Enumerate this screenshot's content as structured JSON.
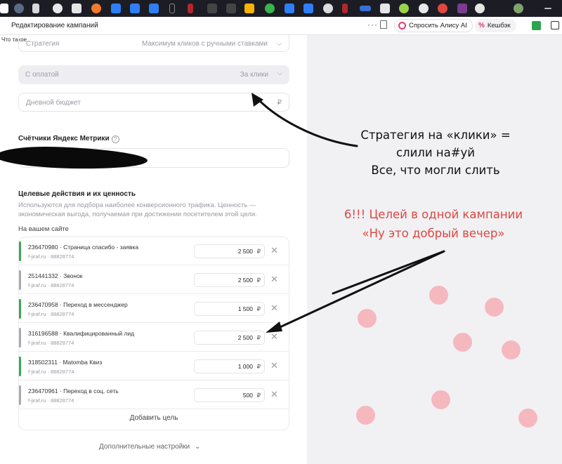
{
  "browser": {
    "page_title": "Редактирование кампаний",
    "more_label": "···",
    "alice_button": "Спросить Алису AI",
    "cashback_button": "Кешбэк",
    "bookmark_hint": "Что такое"
  },
  "form": {
    "strategy": {
      "label": "Стратегия",
      "value": "Максимум кликов с ручными ставками"
    },
    "payment": {
      "label": "С оплатой",
      "value": "За клики"
    },
    "budget": {
      "placeholder": "Дневной бюджет",
      "currency": "₽"
    },
    "metrika_title": "Счётчики Яндекс Метрики",
    "goals_title": "Целевые действия и их ценность",
    "goals_description": "Используются для подбора наиболее конверсионного трафика. Ценность — экономическая выгода, получаемая при достижении посетителем этой цели.",
    "on_site_label": "На вашем сайте",
    "goals": [
      {
        "name": "236470980 · Страница спасибо - заявка",
        "site": "f-jiraf.ru · 88828774",
        "value": "2 500",
        "currency": "₽",
        "status_color": "#3aa757"
      },
      {
        "name": "251441332 · Звонок",
        "site": "f-jiraf.ru · 88828774",
        "value": "2 500",
        "currency": "₽",
        "status_color": "#a9a9b0"
      },
      {
        "name": "236470958 · Переход в мессенджер",
        "site": "f-jiraf.ru · 88828774",
        "value": "1 500",
        "currency": "₽",
        "status_color": "#3aa757"
      },
      {
        "name": "316196588 · Квалифицированный лид",
        "site": "f-jiraf.ru · 88828774",
        "value": "2 500",
        "currency": "₽",
        "status_color": "#a9a9b0"
      },
      {
        "name": "318502311 · Matomba Квиз",
        "site": "f-jiraf.ru · 88828774",
        "value": "1 000",
        "currency": "₽",
        "status_color": "#3aa757"
      },
      {
        "name": "236470961 · Переход в соц. сеть",
        "site": "f-jiraf.ru · 88828774",
        "value": "500",
        "currency": "₽",
        "status_color": "#a9a9b0"
      }
    ],
    "add_goal_label": "Добавить цель",
    "more_settings_label": "Дополнительные настройки"
  },
  "annotations": {
    "black_lines": [
      "Стратегия на «клики» =",
      "слили на#уй",
      "Все, что могли слить"
    ],
    "red_lines": [
      "6!!! Целей в одной кампании",
      "«Ну это добрый вечер»"
    ]
  },
  "colors": {
    "annotation_red": "#e0463f",
    "decor_dots": "#f5b8bf",
    "goal_active": "#3aa757",
    "goal_inactive": "#a9a9b0"
  }
}
